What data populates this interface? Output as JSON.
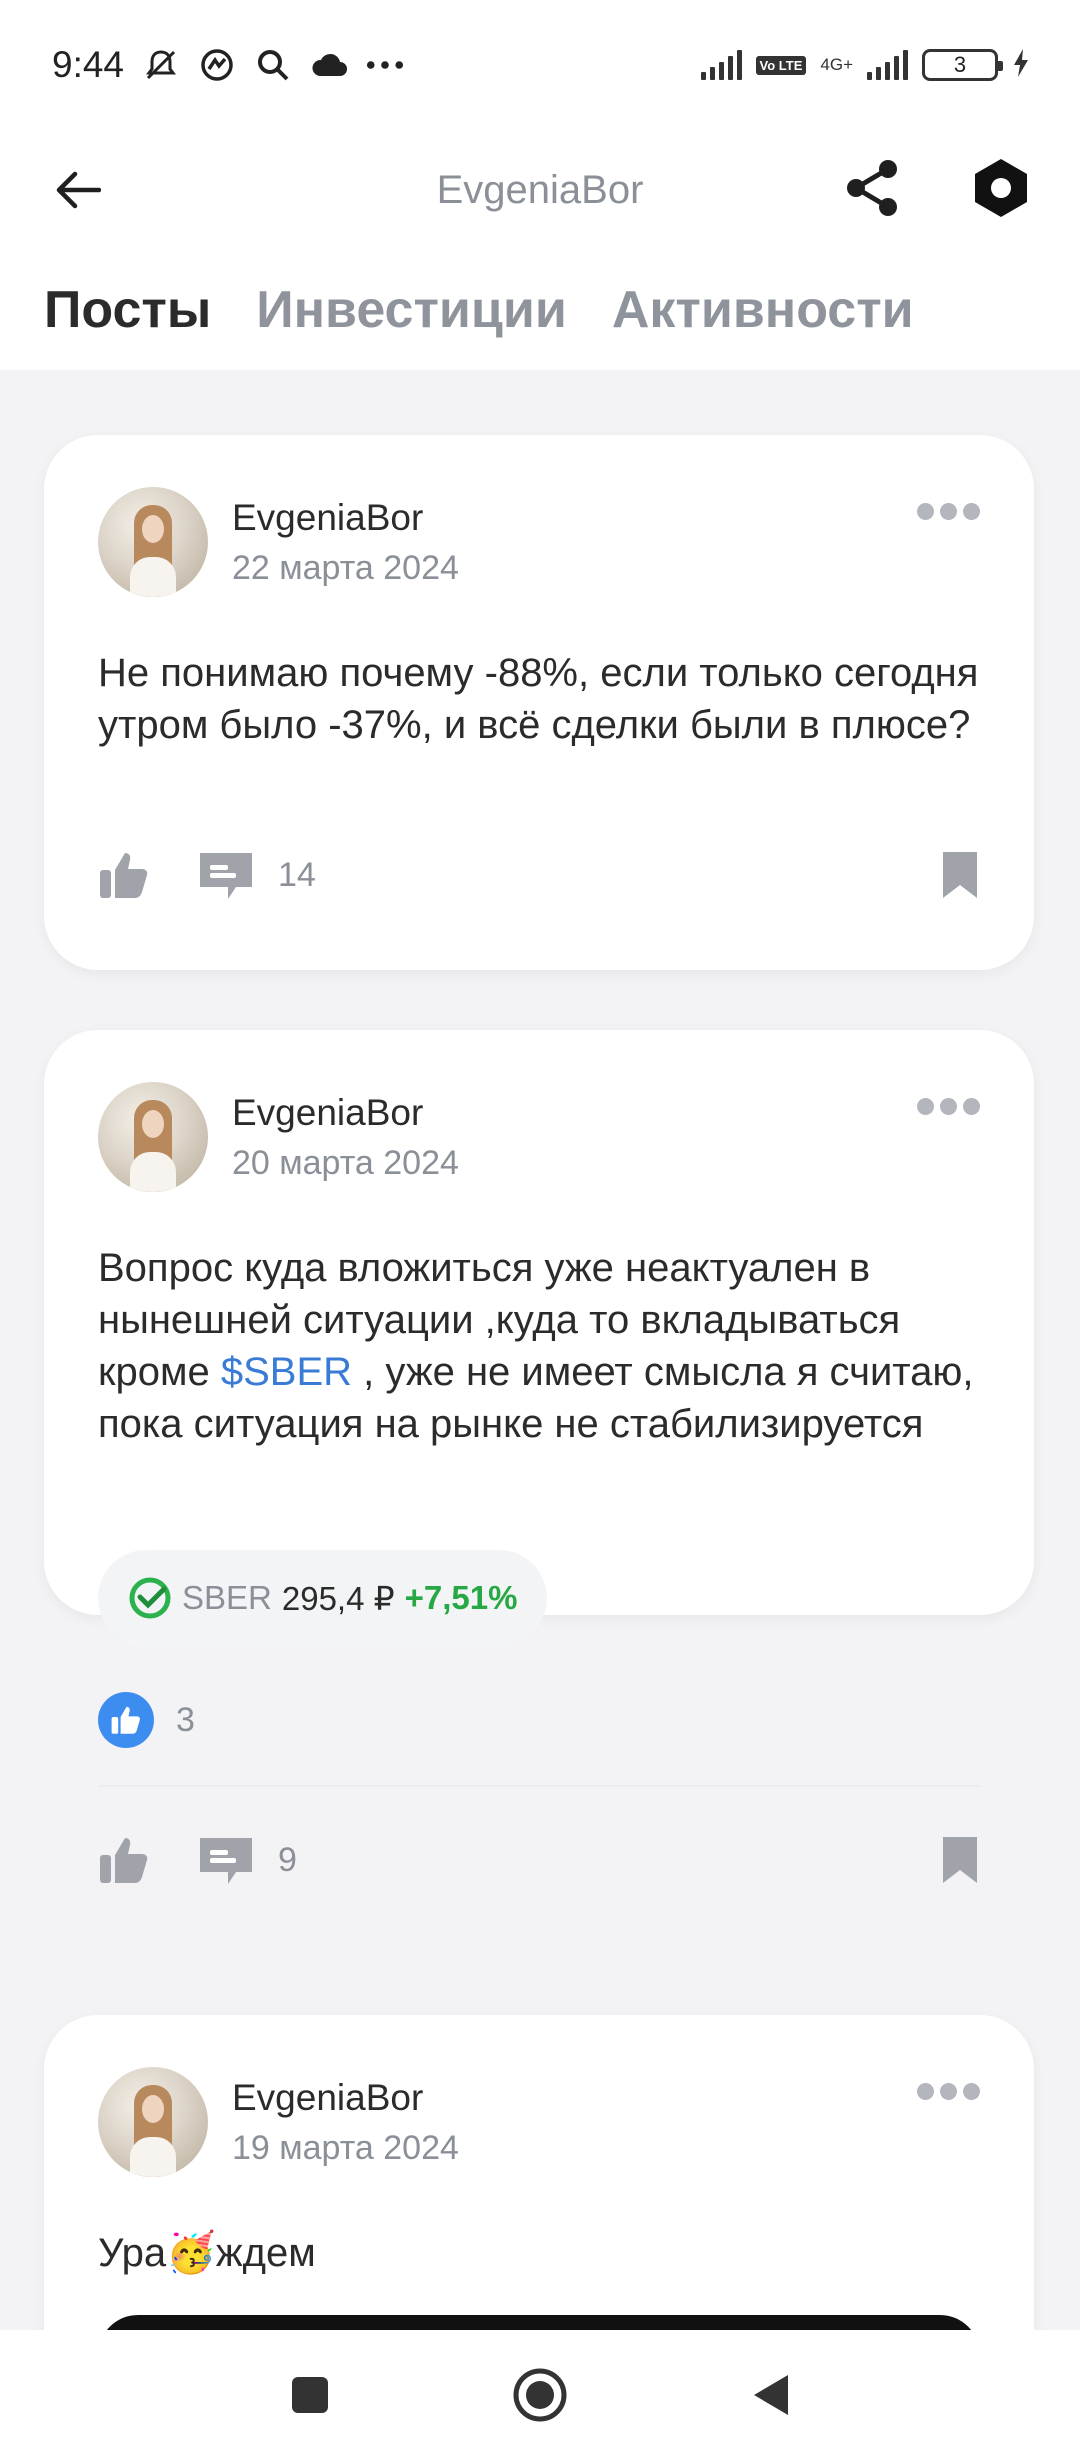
{
  "status_bar": {
    "time": "9:44",
    "icons": [
      "notifications-muted-icon",
      "sync-icon",
      "search-icon",
      "cloud-icon",
      "more-dots-icon"
    ],
    "volte": "Vo LTE",
    "network": "4G+",
    "battery": "3"
  },
  "header": {
    "title": "EvgeniaBor",
    "tabs": [
      {
        "label": "Посты",
        "active": true
      },
      {
        "label": "Инвестиции",
        "active": false
      },
      {
        "label": "Активности",
        "active": false
      }
    ]
  },
  "posts": [
    {
      "author": "EvgeniaBor",
      "date": "22 марта 2024",
      "text": "Не понимаю почему -88%, если только сегодня утром было -37%, и всё сделки были в плюсе?",
      "comments": "14"
    },
    {
      "author": "EvgeniaBor",
      "date": "20 марта 2024",
      "text_before": "Вопрос куда вложиться уже неактуален в нынешней ситуации ,куда то вкладываться кроме ",
      "ticker_link": "$SBER",
      "text_after": " , уже не имеет смысла я считаю, пока ситуация на рынке не стабилизируется",
      "quote": {
        "ticker": "SBER",
        "price": "295,4 ₽",
        "change": "+7,51%"
      },
      "likes": "3",
      "comments": "9"
    },
    {
      "author": "EvgeniaBor",
      "date": "19 марта 2024",
      "text_before": "Ура",
      "emoji": "🥳",
      "text_after": "ждем"
    }
  ],
  "colors": {
    "accent_blue": "#3a7bd5",
    "positive_green": "#27a844",
    "muted_gray": "#8a8f98"
  }
}
